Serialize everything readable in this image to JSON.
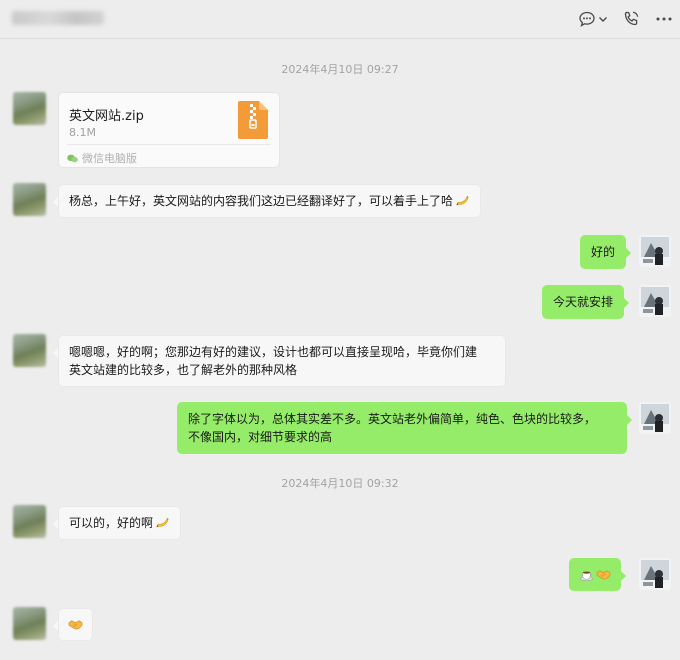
{
  "header": {
    "contact_name_blurred": true,
    "icons": [
      "chat-more-icon",
      "chevron-down-icon",
      "voice-call-icon",
      "more-icon"
    ]
  },
  "timestamps": [
    "2024年4月10日 09:27",
    "2024年4月10日 09:32"
  ],
  "file_message": {
    "file_name": "英文网站.zip",
    "file_size": "8.1M",
    "source": "微信电脑版",
    "icon": "zip-file-icon"
  },
  "messages": {
    "m1": "杨总，上午好，英文网站的内容我们这边已经翻译好了，可以着手上了哈",
    "m2": "好的",
    "m3": "今天就安排",
    "m4_line1": "嗯嗯嗯，好的啊；您那边有好的建议，设计也都可以直接呈现哈，毕竟你们建",
    "m4_line2": "英文站建的比较多，也了解老外的那种风格",
    "m5_line1": "除了字体以为，总体其实差不多。英文站老外偏简单，纯色、色块的比较多，",
    "m5_line2": "不像国内，对细节要求的高",
    "m6": "可以的，好的啊"
  },
  "emoji_names": {
    "m1": "banana-emoji",
    "m6": "banana-emoji",
    "m7": [
      "coffee-emoji",
      "handshake-emoji"
    ],
    "m8": "handshake-emoji"
  },
  "colors": {
    "background": "#ededed",
    "bubble_self": "#95ec69",
    "bubble_other": "#f7f7f7",
    "timestamp": "#a3a3a3",
    "zip_icon": "#f29b38"
  }
}
